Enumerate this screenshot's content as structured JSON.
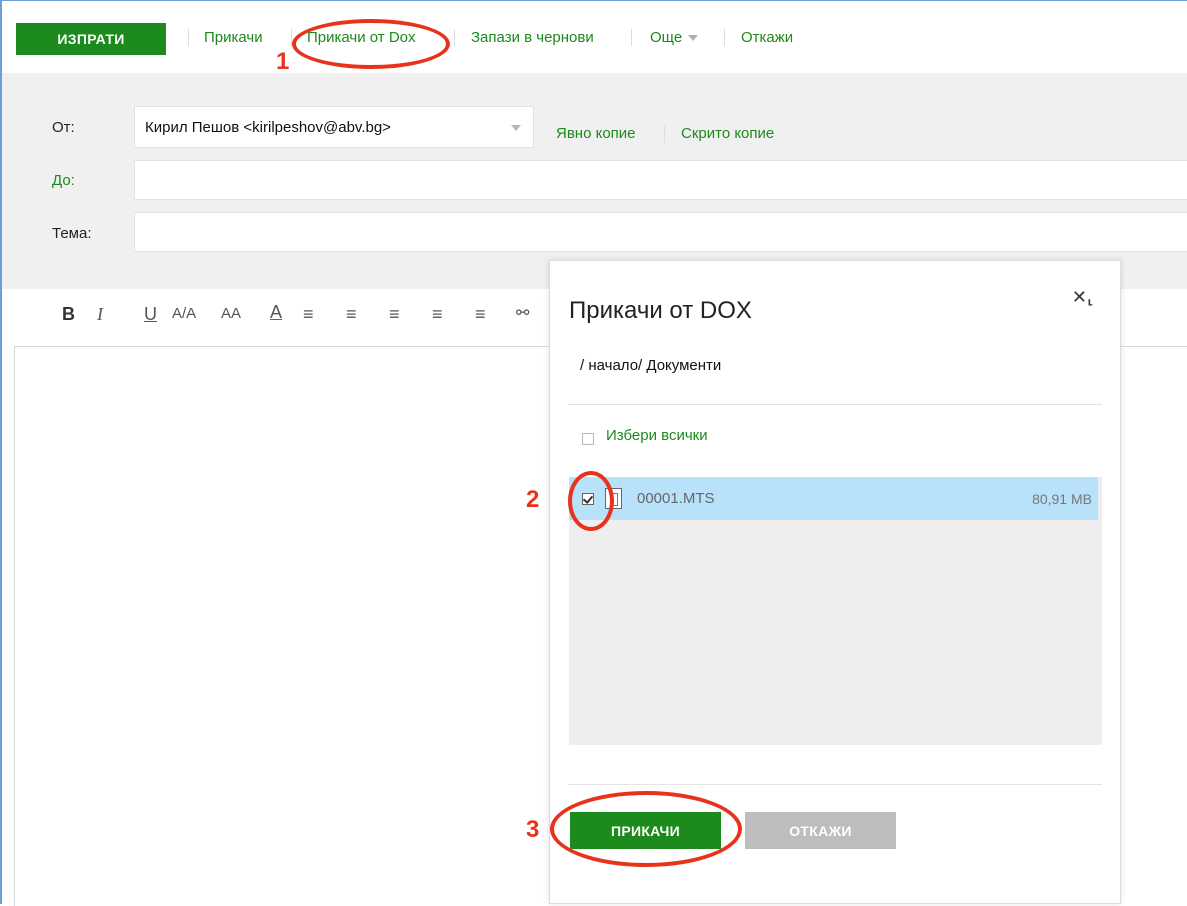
{
  "toolbar": {
    "send_label": "ИЗПРАТИ",
    "attach_label": "Прикачи",
    "attach_dox_label": "Прикачи от Dox",
    "save_draft_label": "Запази в чернови",
    "more_label": "Още",
    "cancel_label": "Откажи"
  },
  "compose": {
    "from_label": "От:",
    "from_value": "Кирил Пешов <kirilpeshov@abv.bg>",
    "cc_label": "Явно копие",
    "bcc_label": "Скрито копие",
    "to_label": "До:",
    "to_value": "",
    "subject_label": "Тема:",
    "subject_value": ""
  },
  "format_bar": {
    "bold": "B",
    "italic": "I",
    "underline": "U",
    "font_size": "A/A",
    "font_case": "AA",
    "font_color": "A"
  },
  "dialog": {
    "title": "Прикачи от DOX",
    "close_icon": "close-icon",
    "breadcrumb": "/ начало/ Документи",
    "select_all_label": "Избери всички",
    "files": [
      {
        "name": "00001.MTS",
        "size": "80,91 MB",
        "selected": true
      }
    ],
    "attach_button": "ПРИКАЧИ",
    "cancel_button": "ОТКАЖИ"
  },
  "annotations": {
    "step1": "1",
    "step2": "2",
    "step3": "3",
    "color": "#e8331c"
  },
  "colors": {
    "brand_green": "#1c8a1c",
    "selected_row": "#b8e1fa"
  }
}
